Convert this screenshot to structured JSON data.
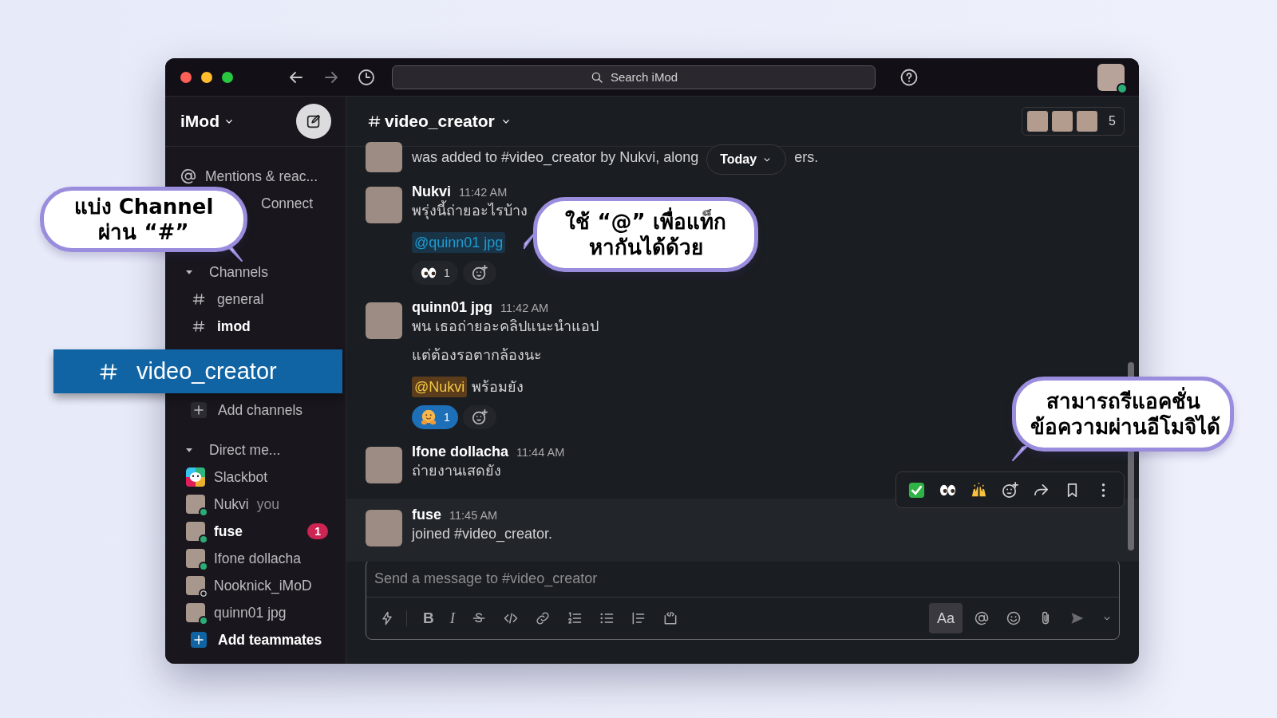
{
  "toolbar": {
    "search_placeholder": "Search iMod"
  },
  "sidebar": {
    "workspace": "iMod",
    "nav": [
      {
        "label": "Mentions & reac..."
      },
      {
        "label": "Connect"
      }
    ],
    "channels_section": {
      "label": "Channels",
      "expanded": true,
      "add_label": "Add channels",
      "items": [
        {
          "name": "general",
          "unread": false,
          "selected": false
        },
        {
          "name": "imod",
          "unread": true,
          "selected": false
        },
        {
          "name": "video_creator",
          "unread": false,
          "selected": true
        }
      ]
    },
    "dm_section": {
      "label": "Direct me...",
      "expanded": true,
      "add_label": "Add teammates",
      "items": [
        {
          "kind": "bot",
          "name": "Slackbot",
          "unread": false
        },
        {
          "kind": "person",
          "name": "Nukvi",
          "note": "you",
          "unread": false,
          "online": true
        },
        {
          "kind": "person",
          "name": "fuse",
          "badge": "1",
          "unread": true,
          "online": true
        },
        {
          "kind": "person",
          "name": "Ifone dollacha",
          "unread": false,
          "online": true
        },
        {
          "kind": "person",
          "name": "Nooknick_iMoD",
          "unread": false,
          "online": false
        },
        {
          "kind": "person",
          "name": "quinn01 jpg",
          "unread": false,
          "online": true
        }
      ]
    }
  },
  "channel": {
    "name": "video_creator",
    "member_count": "5",
    "date_pill": "Today",
    "messages": [
      {
        "kind": "system",
        "text_before": "was added to #video_creator by Nukvi, along",
        "text_after": "ers.",
        "hovered": false
      },
      {
        "kind": "message",
        "author": "Nukvi",
        "time": "11:42 AM",
        "hovered": false,
        "blocks": [
          {
            "kind": "text",
            "text": "พรุ่งนี้ถ่ายอะไรบ้าง"
          },
          {
            "kind": "mention",
            "mention": "@quinn01 jpg",
            "self": false
          }
        ],
        "reactions": [
          {
            "kind": "eyes",
            "count": "1",
            "selected": false
          }
        ]
      },
      {
        "kind": "message",
        "author": "quinn01 jpg",
        "time": "11:42 AM",
        "hovered": false,
        "blocks": [
          {
            "kind": "text",
            "text": "พน เธอถ่ายอะคลิปแนะนำแอป"
          },
          {
            "kind": "text",
            "text": "แต่ต้องรอตากล้องนะ"
          },
          {
            "kind": "mention",
            "mention": "@Nukvi",
            "self": true,
            "text": "พร้อมยัง"
          }
        ],
        "reactions": [
          {
            "kind": "hug",
            "count": "1",
            "selected": true
          }
        ]
      },
      {
        "kind": "message",
        "author": "Ifone dollacha",
        "time": "11:44 AM",
        "hovered": false,
        "blocks": [
          {
            "kind": "text",
            "text": "ถ่ายงานเสดยัง"
          }
        ]
      },
      {
        "kind": "message",
        "author": "fuse",
        "time": "11:45 AM",
        "hovered": true,
        "blocks": [
          {
            "kind": "text",
            "text": "joined #video_creator."
          }
        ]
      }
    ],
    "hover_toolbar": {
      "quick_reactions": [
        {
          "kind": "check"
        },
        {
          "kind": "eyes"
        },
        {
          "kind": "hands"
        }
      ]
    }
  },
  "composer": {
    "placeholder": "Send a message to #video_creator",
    "format_label": "Aa",
    "tools": [
      {
        "kind": "shortcut"
      },
      {
        "kind": "bold",
        "label": "B"
      },
      {
        "kind": "italic",
        "label": "I"
      },
      {
        "kind": "strike"
      },
      {
        "kind": "code"
      },
      {
        "kind": "link"
      },
      {
        "kind": "ol"
      },
      {
        "kind": "ul"
      },
      {
        "kind": "quote"
      },
      {
        "kind": "codeblock"
      }
    ]
  },
  "callouts": [
    {
      "lines": [
        "แบ่ง Channel",
        "ผ่าน “#”"
      ]
    },
    {
      "lines": [
        "ใช้ “@” เพื่อแท็ก",
        "หากันได้ด้วย"
      ]
    },
    {
      "lines": [
        "สามารถรีแอคชั่น",
        "ข้อความผ่านอีโมจิได้"
      ]
    }
  ]
}
